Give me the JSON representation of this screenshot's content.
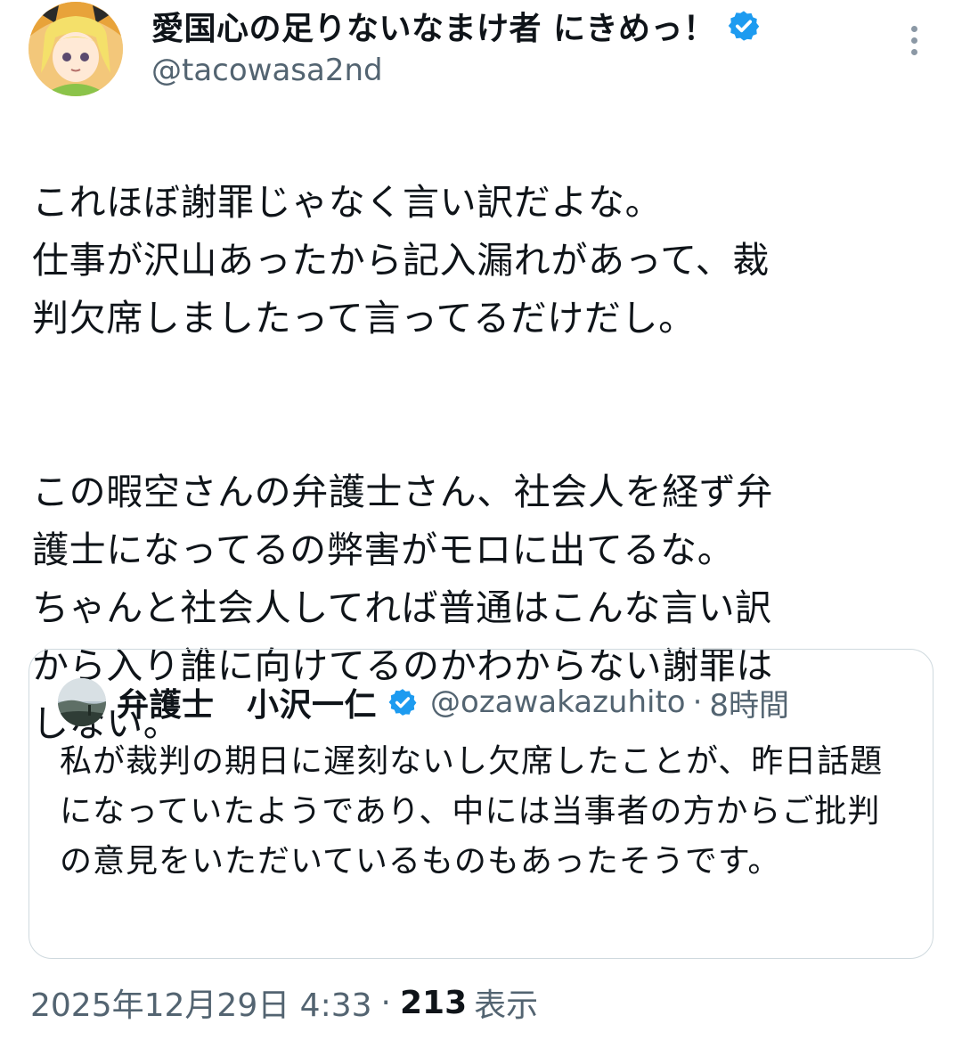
{
  "author": {
    "display_name": "愛国心の足りないなまけ者 にきめっ！",
    "handle": "@tacowasa2nd",
    "verified_icon": "verified-badge-icon"
  },
  "body": {
    "paragraphs": [
      "これほぼ謝罪じゃなく言い訳だよな。\n仕事が沢山あったから記入漏れがあって、裁\n判欠席しましたって言ってるだけだし。",
      "この暇空さんの弁護士さん、社会人を経ず弁\n護士になってるの弊害がモロに出てるな。\nちゃんと社会人してれば普通はこんな言い訳\nから入り誰に向けてるのかわからない謝罪は\nしない。"
    ]
  },
  "quote": {
    "display_name": "弁護士　小沢一仁",
    "handle": "@ozawakazuhito",
    "dot": "·",
    "time": "8時間",
    "text": "私が裁判の期日に遅刻ないし欠席したことが、昨日話題になっていたようであり、中には当事者の方からご批判の意見をいただいているものもあったそうです。"
  },
  "footer": {
    "timestamp": "2025年12月29日 4:33",
    "separator": "·",
    "views_count": "213",
    "views_label": "表示"
  },
  "colors": {
    "text": "#0f1419",
    "secondary": "#536471",
    "verified": "#1d9bf0",
    "border": "#cfd9de"
  }
}
